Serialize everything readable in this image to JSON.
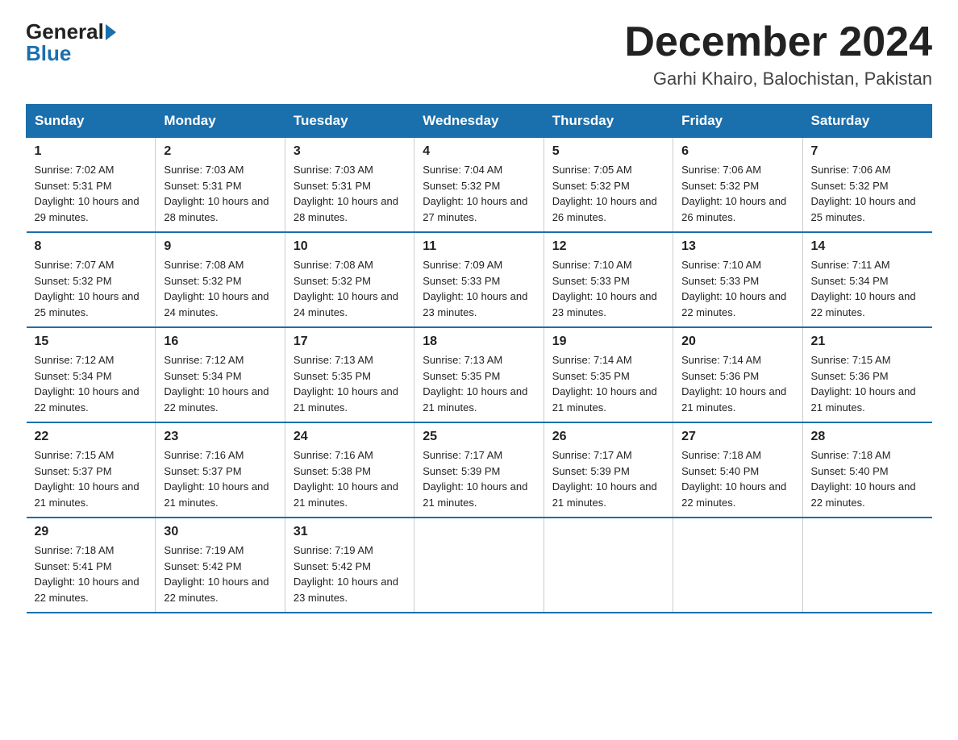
{
  "logo": {
    "general": "General",
    "blue": "Blue"
  },
  "title": "December 2024",
  "subtitle": "Garhi Khairo, Balochistan, Pakistan",
  "days_of_week": [
    "Sunday",
    "Monday",
    "Tuesday",
    "Wednesday",
    "Thursday",
    "Friday",
    "Saturday"
  ],
  "weeks": [
    [
      {
        "day": "1",
        "sunrise": "7:02 AM",
        "sunset": "5:31 PM",
        "daylight": "10 hours and 29 minutes."
      },
      {
        "day": "2",
        "sunrise": "7:03 AM",
        "sunset": "5:31 PM",
        "daylight": "10 hours and 28 minutes."
      },
      {
        "day": "3",
        "sunrise": "7:03 AM",
        "sunset": "5:31 PM",
        "daylight": "10 hours and 28 minutes."
      },
      {
        "day": "4",
        "sunrise": "7:04 AM",
        "sunset": "5:32 PM",
        "daylight": "10 hours and 27 minutes."
      },
      {
        "day": "5",
        "sunrise": "7:05 AM",
        "sunset": "5:32 PM",
        "daylight": "10 hours and 26 minutes."
      },
      {
        "day": "6",
        "sunrise": "7:06 AM",
        "sunset": "5:32 PM",
        "daylight": "10 hours and 26 minutes."
      },
      {
        "day": "7",
        "sunrise": "7:06 AM",
        "sunset": "5:32 PM",
        "daylight": "10 hours and 25 minutes."
      }
    ],
    [
      {
        "day": "8",
        "sunrise": "7:07 AM",
        "sunset": "5:32 PM",
        "daylight": "10 hours and 25 minutes."
      },
      {
        "day": "9",
        "sunrise": "7:08 AM",
        "sunset": "5:32 PM",
        "daylight": "10 hours and 24 minutes."
      },
      {
        "day": "10",
        "sunrise": "7:08 AM",
        "sunset": "5:32 PM",
        "daylight": "10 hours and 24 minutes."
      },
      {
        "day": "11",
        "sunrise": "7:09 AM",
        "sunset": "5:33 PM",
        "daylight": "10 hours and 23 minutes."
      },
      {
        "day": "12",
        "sunrise": "7:10 AM",
        "sunset": "5:33 PM",
        "daylight": "10 hours and 23 minutes."
      },
      {
        "day": "13",
        "sunrise": "7:10 AM",
        "sunset": "5:33 PM",
        "daylight": "10 hours and 22 minutes."
      },
      {
        "day": "14",
        "sunrise": "7:11 AM",
        "sunset": "5:34 PM",
        "daylight": "10 hours and 22 minutes."
      }
    ],
    [
      {
        "day": "15",
        "sunrise": "7:12 AM",
        "sunset": "5:34 PM",
        "daylight": "10 hours and 22 minutes."
      },
      {
        "day": "16",
        "sunrise": "7:12 AM",
        "sunset": "5:34 PM",
        "daylight": "10 hours and 22 minutes."
      },
      {
        "day": "17",
        "sunrise": "7:13 AM",
        "sunset": "5:35 PM",
        "daylight": "10 hours and 21 minutes."
      },
      {
        "day": "18",
        "sunrise": "7:13 AM",
        "sunset": "5:35 PM",
        "daylight": "10 hours and 21 minutes."
      },
      {
        "day": "19",
        "sunrise": "7:14 AM",
        "sunset": "5:35 PM",
        "daylight": "10 hours and 21 minutes."
      },
      {
        "day": "20",
        "sunrise": "7:14 AM",
        "sunset": "5:36 PM",
        "daylight": "10 hours and 21 minutes."
      },
      {
        "day": "21",
        "sunrise": "7:15 AM",
        "sunset": "5:36 PM",
        "daylight": "10 hours and 21 minutes."
      }
    ],
    [
      {
        "day": "22",
        "sunrise": "7:15 AM",
        "sunset": "5:37 PM",
        "daylight": "10 hours and 21 minutes."
      },
      {
        "day": "23",
        "sunrise": "7:16 AM",
        "sunset": "5:37 PM",
        "daylight": "10 hours and 21 minutes."
      },
      {
        "day": "24",
        "sunrise": "7:16 AM",
        "sunset": "5:38 PM",
        "daylight": "10 hours and 21 minutes."
      },
      {
        "day": "25",
        "sunrise": "7:17 AM",
        "sunset": "5:39 PM",
        "daylight": "10 hours and 21 minutes."
      },
      {
        "day": "26",
        "sunrise": "7:17 AM",
        "sunset": "5:39 PM",
        "daylight": "10 hours and 21 minutes."
      },
      {
        "day": "27",
        "sunrise": "7:18 AM",
        "sunset": "5:40 PM",
        "daylight": "10 hours and 22 minutes."
      },
      {
        "day": "28",
        "sunrise": "7:18 AM",
        "sunset": "5:40 PM",
        "daylight": "10 hours and 22 minutes."
      }
    ],
    [
      {
        "day": "29",
        "sunrise": "7:18 AM",
        "sunset": "5:41 PM",
        "daylight": "10 hours and 22 minutes."
      },
      {
        "day": "30",
        "sunrise": "7:19 AM",
        "sunset": "5:42 PM",
        "daylight": "10 hours and 22 minutes."
      },
      {
        "day": "31",
        "sunrise": "7:19 AM",
        "sunset": "5:42 PM",
        "daylight": "10 hours and 23 minutes."
      },
      {
        "day": "",
        "sunrise": "",
        "sunset": "",
        "daylight": ""
      },
      {
        "day": "",
        "sunrise": "",
        "sunset": "",
        "daylight": ""
      },
      {
        "day": "",
        "sunrise": "",
        "sunset": "",
        "daylight": ""
      },
      {
        "day": "",
        "sunrise": "",
        "sunset": "",
        "daylight": ""
      }
    ]
  ]
}
